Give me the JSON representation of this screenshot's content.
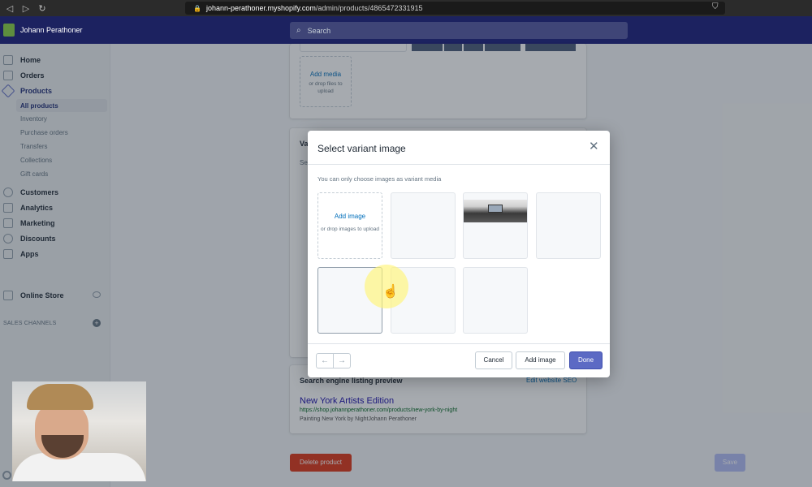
{
  "browser": {
    "url_domain": "johann-perathoner.myshopify.com",
    "url_path": "/admin/products/4865472331915"
  },
  "topbar": {
    "store_name": "Johann Perathoner",
    "search_placeholder": "Search"
  },
  "sidebar": {
    "items": [
      {
        "label": "Home",
        "icon": "home-icon"
      },
      {
        "label": "Orders",
        "icon": "orders-icon"
      },
      {
        "label": "Products",
        "icon": "tag-icon"
      },
      {
        "label": "Customers",
        "icon": "person-icon"
      },
      {
        "label": "Analytics",
        "icon": "bar-chart-icon"
      },
      {
        "label": "Marketing",
        "icon": "megaphone-icon"
      },
      {
        "label": "Discounts",
        "icon": "discount-icon"
      },
      {
        "label": "Apps",
        "icon": "apps-icon"
      }
    ],
    "product_subitems": [
      "All products",
      "Inventory",
      "Purchase orders",
      "Transfers",
      "Collections",
      "Gift cards"
    ],
    "sales_channels_label": "SALES CHANNELS",
    "online_store_label": "Online Store"
  },
  "media": {
    "add_media_label": "Add media",
    "drop_hint": "or drop files to upload"
  },
  "variants": {
    "partial_title": "Va",
    "partial_sub": "Se"
  },
  "seo": {
    "title": "Search engine listing preview",
    "edit_link": "Edit website SEO",
    "page_name": "New York Artists Edition",
    "url": "https://shop.johannperathoner.com/products/new-york-by-night",
    "description": "Painting New York by NightJohann Perathoner"
  },
  "footer": {
    "delete_label": "Delete product",
    "save_label": "Save"
  },
  "modal": {
    "title": "Select variant image",
    "note": "You can only choose images as variant media",
    "upload_label": "Add image",
    "upload_hint": "or drop images to upload",
    "cancel_label": "Cancel",
    "add_image_label": "Add image",
    "done_label": "Done"
  }
}
